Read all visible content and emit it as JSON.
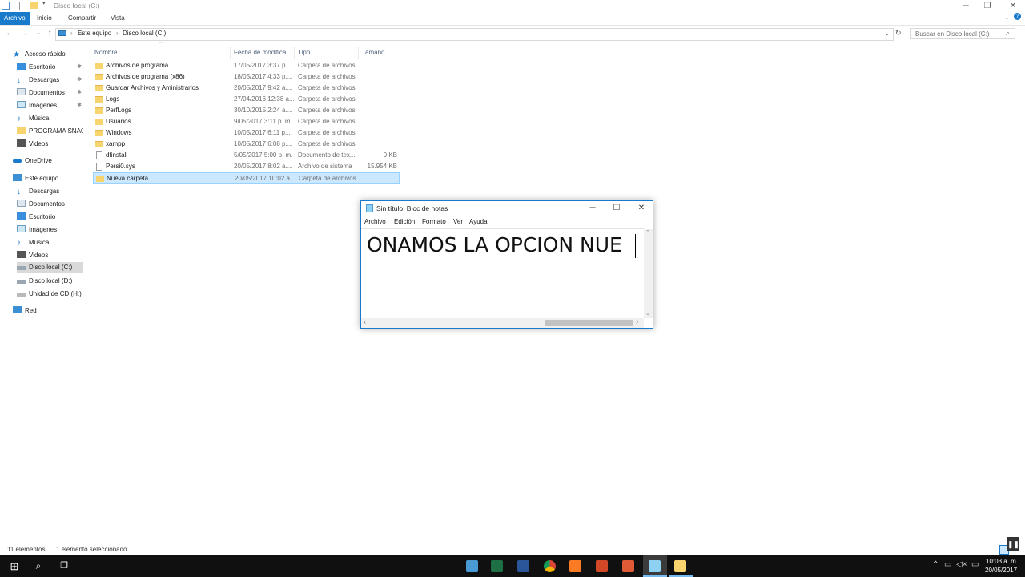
{
  "window": {
    "title": "Disco local (C:)"
  },
  "ribbon": {
    "tabs": [
      "Archivo",
      "Inicio",
      "Compartir",
      "Vista"
    ]
  },
  "address": {
    "crumbs": [
      "Este equipo",
      "Disco local (C:)"
    ],
    "search_placeholder": "Buscar en Disco local (C:)"
  },
  "nav": {
    "quick_access": "Acceso rápido",
    "quick_items": [
      "Escritorio",
      "Descargas",
      "Documentos",
      "Imágenes",
      "Música",
      "PROGRAMA SNAGI",
      "Videos"
    ],
    "onedrive": "OneDrive",
    "this_pc": "Este equipo",
    "pc_items": [
      "Descargas",
      "Documentos",
      "Escritorio",
      "Imágenes",
      "Música",
      "Videos",
      "Disco local (C:)",
      "Disco local (D:)",
      "Unidad de CD (H:)"
    ],
    "network": "Red"
  },
  "columns": {
    "name": "Nombre",
    "date": "Fecha de modifica...",
    "type": "Tipo",
    "size": "Tamaño"
  },
  "files": [
    {
      "name": "Archivos de programa",
      "date": "17/05/2017 3:37 p....",
      "type": "Carpeta de archivos",
      "size": ""
    },
    {
      "name": "Archivos de programa (x86)",
      "date": "18/05/2017 4:33 p....",
      "type": "Carpeta de archivos",
      "size": ""
    },
    {
      "name": "Guardar Archivos y Aministrarlos",
      "date": "20/05/2017 9:42 a....",
      "type": "Carpeta de archivos",
      "size": ""
    },
    {
      "name": "Logs",
      "date": "27/04/2016 12:38 a....",
      "type": "Carpeta de archivos",
      "size": ""
    },
    {
      "name": "PerfLogs",
      "date": "30/10/2015 2:24 a....",
      "type": "Carpeta de archivos",
      "size": ""
    },
    {
      "name": "Usuarios",
      "date": "9/05/2017 3:11 p. m.",
      "type": "Carpeta de archivos",
      "size": ""
    },
    {
      "name": "Windows",
      "date": "10/05/2017 6:11 p....",
      "type": "Carpeta de archivos",
      "size": ""
    },
    {
      "name": "xampp",
      "date": "10/05/2017 6:08 p....",
      "type": "Carpeta de archivos",
      "size": ""
    },
    {
      "name": "dfinstall",
      "date": "5/05/2017 5:00 p. m.",
      "type": "Documento de tex...",
      "size": "0 KB"
    },
    {
      "name": "Persi0.sys",
      "date": "20/05/2017 8:02 a....",
      "type": "Archivo de sistema",
      "size": "15.954 KB"
    },
    {
      "name": "Nueva carpeta",
      "date": "20/05/2017 10:02 a....",
      "type": "Carpeta de archivos",
      "size": ""
    }
  ],
  "status": {
    "count": "11 elementos",
    "selected": "1 elemento seleccionado"
  },
  "notepad": {
    "title": "Sin título: Bloc de notas",
    "menu": [
      "Archivo",
      "Edición",
      "Formato",
      "Ver",
      "Ayuda"
    ],
    "content": "ONAMOS LA OPCION NUE"
  },
  "clock": {
    "time": "10:03 a. m.",
    "date": "20/05/2017"
  }
}
